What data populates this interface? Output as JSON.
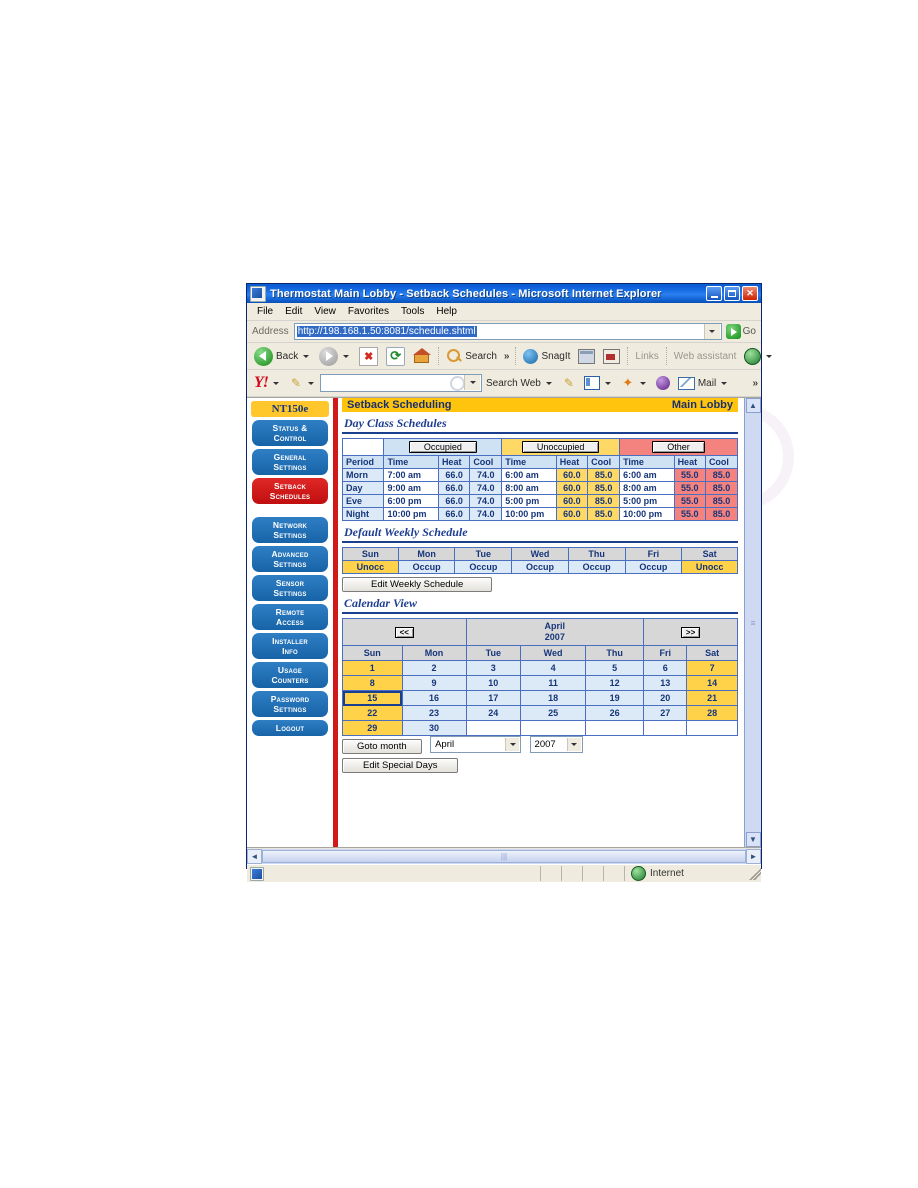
{
  "window": {
    "title": "Thermostat Main Lobby - Setback Schedules - Microsoft Internet Explorer",
    "icon": "ie-document-icon",
    "buttons": {
      "minimize": "minimize-button",
      "maximize": "maximize-button",
      "close": "close-button"
    }
  },
  "menubar": {
    "items": [
      "File",
      "Edit",
      "View",
      "Favorites",
      "Tools",
      "Help"
    ]
  },
  "address": {
    "label": "Address",
    "url": "http://198.168.1.50:8081/schedule.shtml",
    "go_label": "Go"
  },
  "toolbar": {
    "back": "Back",
    "forward": "",
    "stop": "",
    "refresh": "",
    "home": "",
    "search": "Search",
    "overflow": "»",
    "snagit": "SnagIt",
    "links": "Links",
    "web_assistant": "Web assistant"
  },
  "yahoo_toolbar": {
    "logo": "Y!",
    "search_value": "",
    "search_web": "Search Web",
    "mail": "Mail",
    "overflow": "»"
  },
  "sidebar": {
    "brand": "NT150e",
    "items": [
      {
        "l1": "Status &",
        "l2": "Control",
        "active": false
      },
      {
        "l1": "General",
        "l2": "Settings",
        "active": false
      },
      {
        "l1": "Setback",
        "l2": "Schedules",
        "active": true
      },
      {
        "l1": "Network",
        "l2": "Settings",
        "active": false
      },
      {
        "l1": "Advanced",
        "l2": "Settings",
        "active": false
      },
      {
        "l1": "Sensor",
        "l2": "Settings",
        "active": false
      },
      {
        "l1": "Remote",
        "l2": "Access",
        "active": false
      },
      {
        "l1": "Installer",
        "l2": "Info",
        "active": false
      },
      {
        "l1": "Usage",
        "l2": "Counters",
        "active": false
      },
      {
        "l1": "Password",
        "l2": "Settings",
        "active": false
      },
      {
        "l1": "Logout",
        "l2": "",
        "active": false
      }
    ]
  },
  "header": {
    "title": "Setback Scheduling",
    "location": "Main Lobby"
  },
  "day_class": {
    "section_title": "Day Class Schedules",
    "groups": [
      "Occupied",
      "Unoccupied",
      "Other"
    ],
    "columns": [
      "Period",
      "Time",
      "Heat",
      "Cool",
      "Time",
      "Heat",
      "Cool",
      "Time",
      "Heat",
      "Cool"
    ],
    "rows": [
      {
        "period": "Morn",
        "occ_time": "7:00 am",
        "occ_heat": "66.0",
        "occ_cool": "74.0",
        "un_time": "6:00 am",
        "un_heat": "60.0",
        "un_cool": "85.0",
        "ot_time": "6:00 am",
        "ot_heat": "55.0",
        "ot_cool": "85.0"
      },
      {
        "period": "Day",
        "occ_time": "9:00 am",
        "occ_heat": "66.0",
        "occ_cool": "74.0",
        "un_time": "8:00 am",
        "un_heat": "60.0",
        "un_cool": "85.0",
        "ot_time": "8:00 am",
        "ot_heat": "55.0",
        "ot_cool": "85.0"
      },
      {
        "period": "Eve",
        "occ_time": "6:00 pm",
        "occ_heat": "66.0",
        "occ_cool": "74.0",
        "un_time": "5:00 pm",
        "un_heat": "60.0",
        "un_cool": "85.0",
        "ot_time": "5:00 pm",
        "ot_heat": "55.0",
        "ot_cool": "85.0"
      },
      {
        "period": "Night",
        "occ_time": "10:00 pm",
        "occ_heat": "66.0",
        "occ_cool": "74.0",
        "un_time": "10:00 pm",
        "un_heat": "60.0",
        "un_cool": "85.0",
        "ot_time": "10:00 pm",
        "ot_heat": "55.0",
        "ot_cool": "85.0"
      }
    ]
  },
  "weekly": {
    "section_title": "Default Weekly Schedule",
    "days": [
      "Sun",
      "Mon",
      "Tue",
      "Wed",
      "Thu",
      "Fri",
      "Sat"
    ],
    "values": [
      "Unocc",
      "Occup",
      "Occup",
      "Occup",
      "Occup",
      "Occup",
      "Unocc"
    ],
    "edit_button": "Edit Weekly Schedule"
  },
  "calendar": {
    "section_title": "Calendar View",
    "prev_label": "<<",
    "next_label": ">>",
    "month": "April",
    "year": "2007",
    "day_headers": [
      "Sun",
      "Mon",
      "Tue",
      "Wed",
      "Thu",
      "Fri",
      "Sat"
    ],
    "selected_day": 15,
    "weeks": [
      [
        1,
        2,
        3,
        4,
        5,
        6,
        7
      ],
      [
        8,
        9,
        10,
        11,
        12,
        13,
        14
      ],
      [
        15,
        16,
        17,
        18,
        19,
        20,
        21
      ],
      [
        22,
        23,
        24,
        25,
        26,
        27,
        28
      ],
      [
        29,
        30,
        null,
        null,
        null,
        null,
        null
      ]
    ],
    "goto_button": "Goto month",
    "month_select": "April",
    "year_select": "2007",
    "edit_special_button": "Edit Special Days"
  },
  "colors": {
    "brand_yellow": "#ffc40d",
    "nav_blue": "#2f7fc4",
    "nav_active_red": "#d21919",
    "occupied": "#dceaf7",
    "unoccupied": "#ffd966",
    "other": "#f4837f",
    "text_blue": "#16357a"
  },
  "statusbar": {
    "zone": "Internet"
  }
}
